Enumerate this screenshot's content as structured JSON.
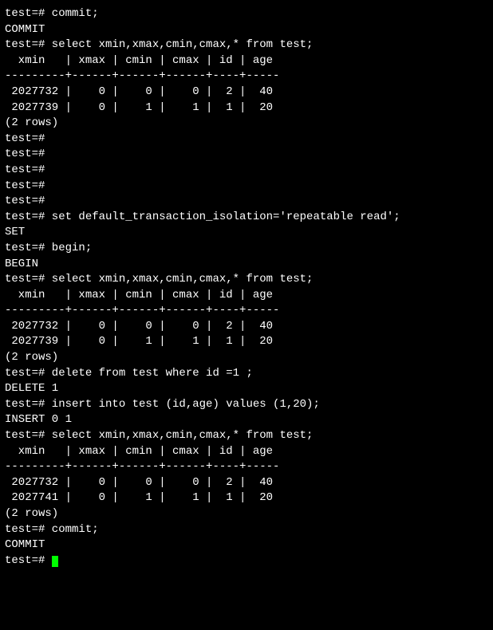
{
  "prompt": "test=#",
  "lines": [
    "test=# commit;",
    "COMMIT",
    "test=# select xmin,xmax,cmin,cmax,* from test;",
    "  xmin   | xmax | cmin | cmax | id | age ",
    "---------+------+------+------+----+-----",
    " 2027732 |    0 |    0 |    0 |  2 |  40",
    " 2027739 |    0 |    1 |    1 |  1 |  20",
    "(2 rows)",
    "",
    "test=# ",
    "test=# ",
    "test=# ",
    "test=# ",
    "test=# ",
    "test=# set default_transaction_isolation='repeatable read';",
    "SET",
    "test=# begin;",
    "BEGIN",
    "test=# select xmin,xmax,cmin,cmax,* from test;",
    "  xmin   | xmax | cmin | cmax | id | age ",
    "---------+------+------+------+----+-----",
    " 2027732 |    0 |    0 |    0 |  2 |  40",
    " 2027739 |    0 |    1 |    1 |  1 |  20",
    "(2 rows)",
    "",
    "test=# delete from test where id =1 ;",
    "DELETE 1",
    "test=# insert into test (id,age) values (1,20);",
    "INSERT 0 1",
    "test=# select xmin,xmax,cmin,cmax,* from test;",
    "  xmin   | xmax | cmin | cmax | id | age ",
    "---------+------+------+------+----+-----",
    " 2027732 |    0 |    0 |    0 |  2 |  40",
    " 2027741 |    0 |    1 |    1 |  1 |  20",
    "(2 rows)",
    "",
    "test=# commit;",
    "COMMIT",
    "test=# "
  ],
  "cursor_color": "#00ff00",
  "database_name": "test",
  "queries": {
    "q1": "commit;",
    "q2": "select xmin,xmax,cmin,cmax,* from test;",
    "q3": "set default_transaction_isolation='repeatable read';",
    "q4": "begin;",
    "q5": "delete from test where id =1 ;",
    "q6": "insert into test (id,age) values (1,20);"
  },
  "table_headers": [
    "xmin",
    "xmax",
    "cmin",
    "cmax",
    "id",
    "age"
  ],
  "result_sets": [
    {
      "rows": [
        {
          "xmin": 2027732,
          "xmax": 0,
          "cmin": 0,
          "cmax": 0,
          "id": 2,
          "age": 40
        },
        {
          "xmin": 2027739,
          "xmax": 0,
          "cmin": 1,
          "cmax": 1,
          "id": 1,
          "age": 20
        }
      ],
      "count_text": "(2 rows)"
    },
    {
      "rows": [
        {
          "xmin": 2027732,
          "xmax": 0,
          "cmin": 0,
          "cmax": 0,
          "id": 2,
          "age": 40
        },
        {
          "xmin": 2027739,
          "xmax": 0,
          "cmin": 1,
          "cmax": 1,
          "id": 1,
          "age": 20
        }
      ],
      "count_text": "(2 rows)"
    },
    {
      "rows": [
        {
          "xmin": 2027732,
          "xmax": 0,
          "cmin": 0,
          "cmax": 0,
          "id": 2,
          "age": 40
        },
        {
          "xmin": 2027741,
          "xmax": 0,
          "cmin": 1,
          "cmax": 1,
          "id": 1,
          "age": 20
        }
      ],
      "count_text": "(2 rows)"
    }
  ],
  "responses": {
    "commit": "COMMIT",
    "set": "SET",
    "begin": "BEGIN",
    "delete": "DELETE 1",
    "insert": "INSERT 0 1"
  }
}
